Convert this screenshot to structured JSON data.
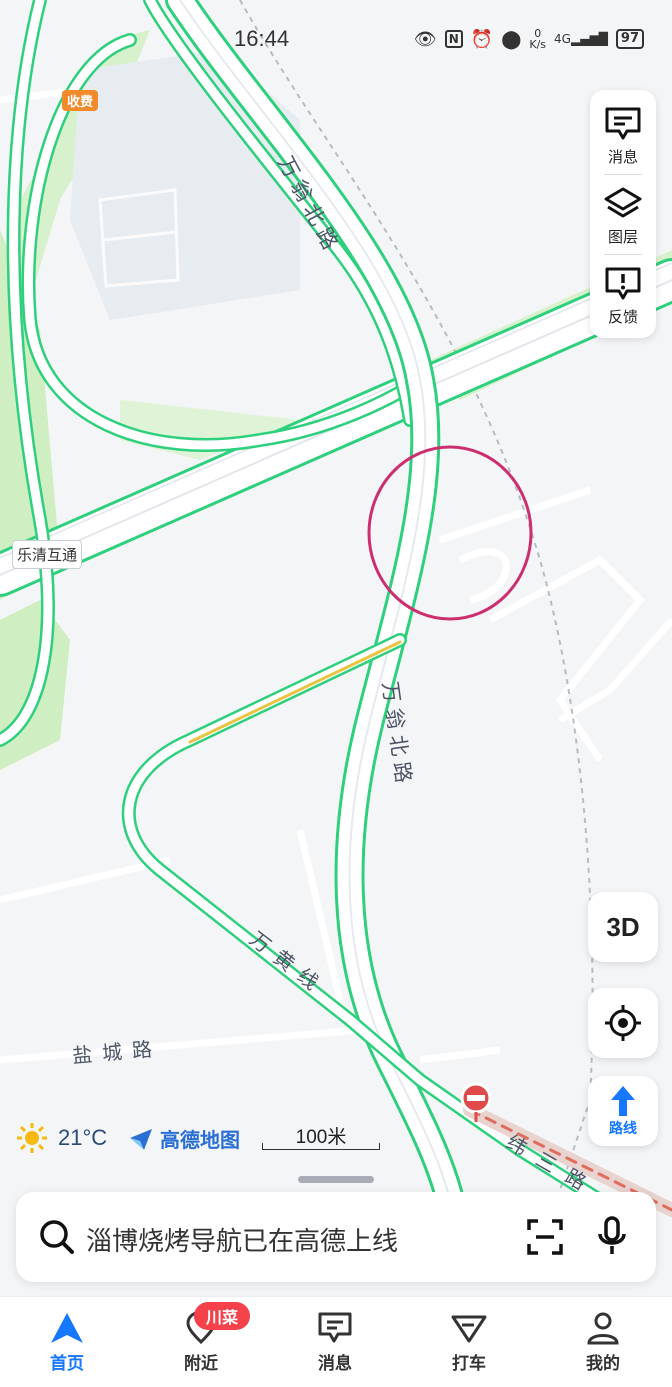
{
  "status_bar": {
    "time": "16:44",
    "net_speed_top": "0",
    "net_speed_unit": "K/s",
    "network": "4G",
    "battery": "97"
  },
  "map": {
    "toll_label": "收费",
    "interchange_label": "乐清互通",
    "road_label_1": "万翁北路",
    "road_label_2": "万翁北路",
    "road_label_3": "万黄线",
    "road_label_4": "盐城路",
    "road_label_5": "纬三路",
    "colors": {
      "road_outline": "#2ecf7d",
      "green_area": "#cfeec2",
      "highlight_circle": "#cc2f70"
    }
  },
  "side_panel": {
    "messages_label": "消息",
    "layers_label": "图层",
    "feedback_label": "反馈"
  },
  "controls": {
    "view_3d_label": "3D",
    "route_label": "路线"
  },
  "info": {
    "temperature": "21°C",
    "brand": "高德地图",
    "scale": "100米"
  },
  "search": {
    "placeholder": "淄博烧烤导航已在高德上线"
  },
  "tabbar": {
    "home": "首页",
    "nearby": "附近",
    "nearby_badge": "川菜",
    "messages": "消息",
    "taxi": "打车",
    "mine": "我的",
    "active_color": "#1677ff"
  }
}
